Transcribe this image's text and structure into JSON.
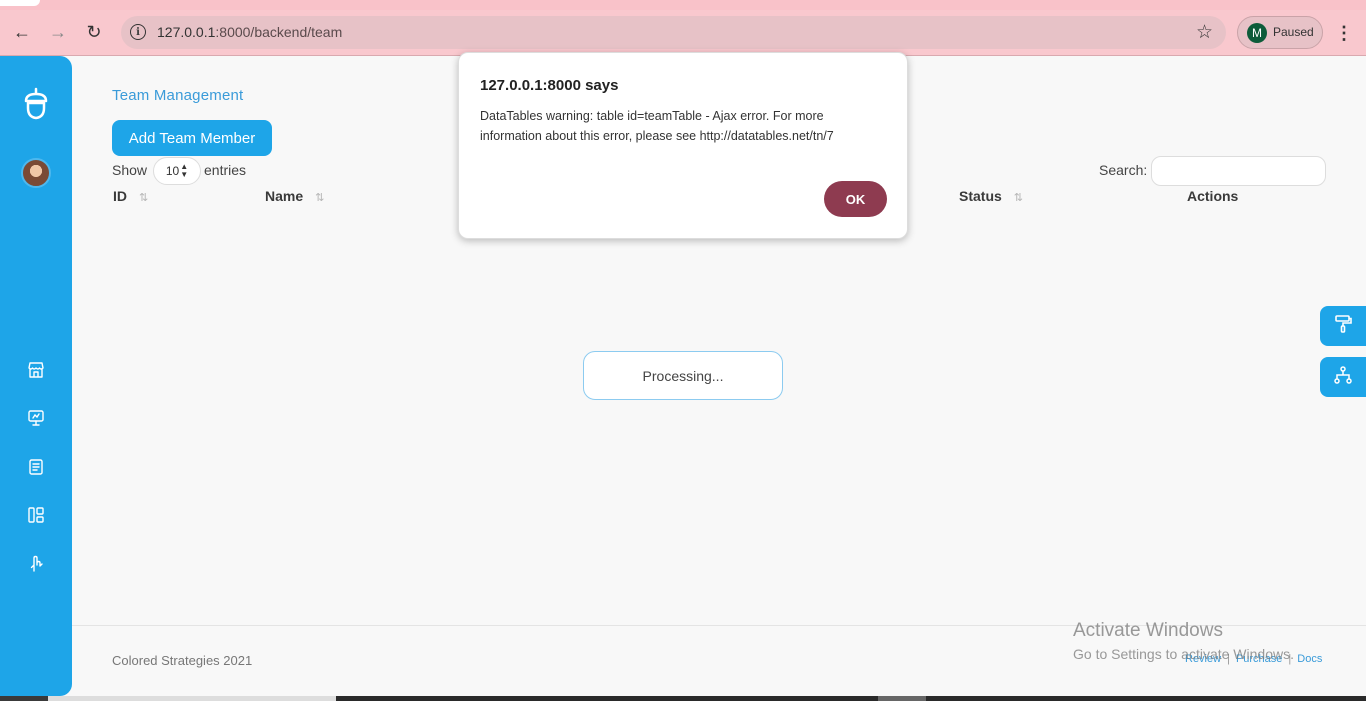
{
  "browser": {
    "url_host": "127.0.0.1",
    "url_rest": ":8000/backend/team",
    "profile_initial": "M",
    "profile_status": "Paused"
  },
  "page": {
    "breadcrumb": "Team Management",
    "add_button": "Add Team Member",
    "show_label": "Show",
    "page_length": "10",
    "entries_label": "entries",
    "search_label": "Search:",
    "search_value": "",
    "columns": {
      "id": "ID",
      "name": "Name",
      "status": "Status",
      "actions": "Actions"
    },
    "processing": "Processing..."
  },
  "footer": {
    "copyright": "Colored Strategies 2021",
    "links": [
      "Review",
      "Purchase",
      "Docs"
    ]
  },
  "watermark": {
    "line1": "Activate Windows",
    "line2": "Go to Settings to activate Windows."
  },
  "dialog": {
    "title": "127.0.0.1:8000 says",
    "message": "DataTables warning: table id=teamTable - Ajax error. For more information about this error, please see http://datatables.net/tn/7",
    "ok_label": "OK"
  },
  "colors": {
    "primary": "#1ea5e8",
    "dialog_button": "#8e3b50",
    "browser_frame": "#f9c8ce"
  },
  "icons": [
    "back-arrow-icon",
    "forward-arrow-icon",
    "reload-icon",
    "site-info-icon",
    "star-icon",
    "kebab-menu-icon",
    "acorn-logo-icon",
    "store-icon",
    "presentation-icon",
    "notebook-icon",
    "layout-icon",
    "hand-gesture-icon",
    "paint-roller-icon",
    "hierarchy-icon",
    "sort-icon"
  ]
}
